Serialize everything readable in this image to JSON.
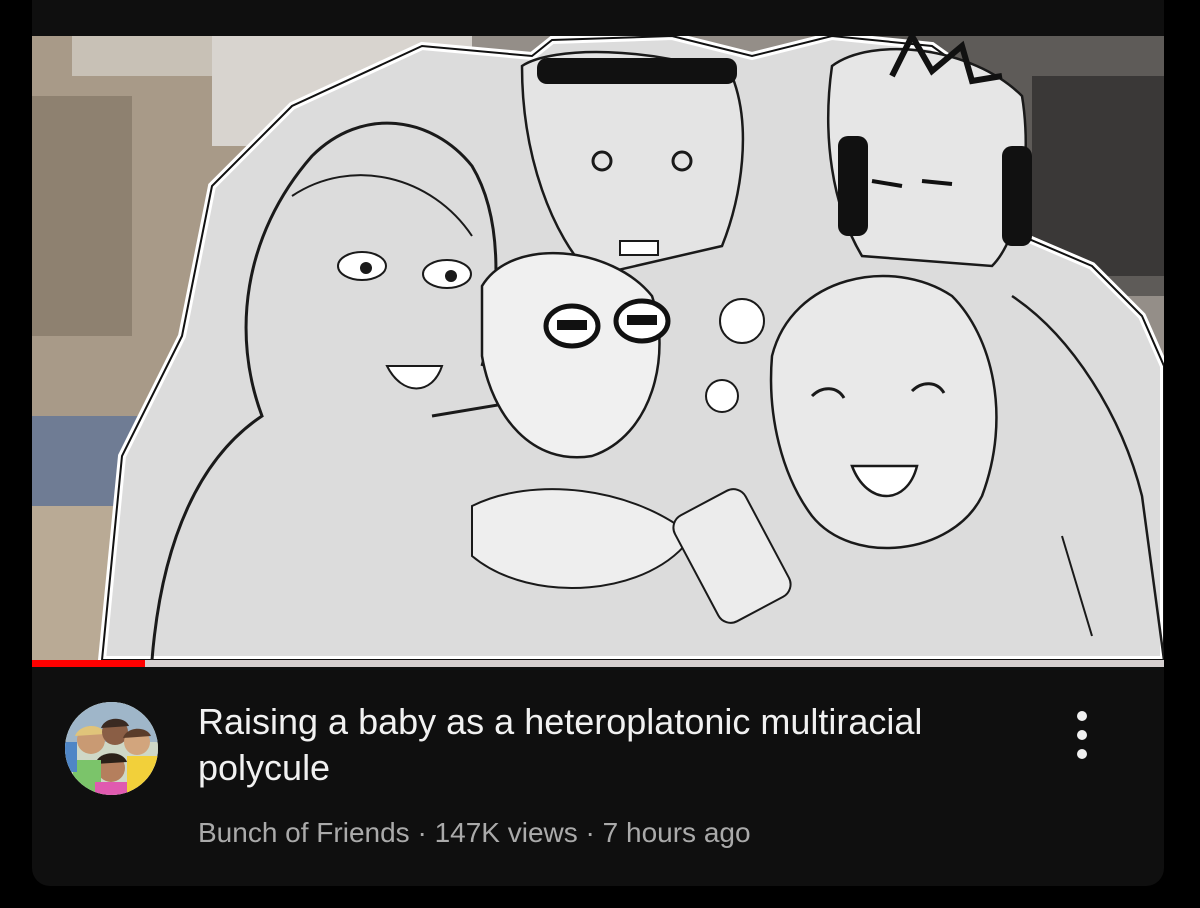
{
  "video": {
    "title": "Raising a baby as a heteroplatonic multiracial polycule",
    "channel": "Bunch of Friends",
    "separator_1": " · ",
    "views": "147K views",
    "separator_2": " · ",
    "age": "7 hours ago",
    "watch_progress": 0.1,
    "more_icon": "more-vertical-icon"
  },
  "colors": {
    "progress": "#ff0000",
    "title": "#f1f1f1",
    "meta": "#aaaaaa",
    "card_background": "#0f0f0f"
  }
}
